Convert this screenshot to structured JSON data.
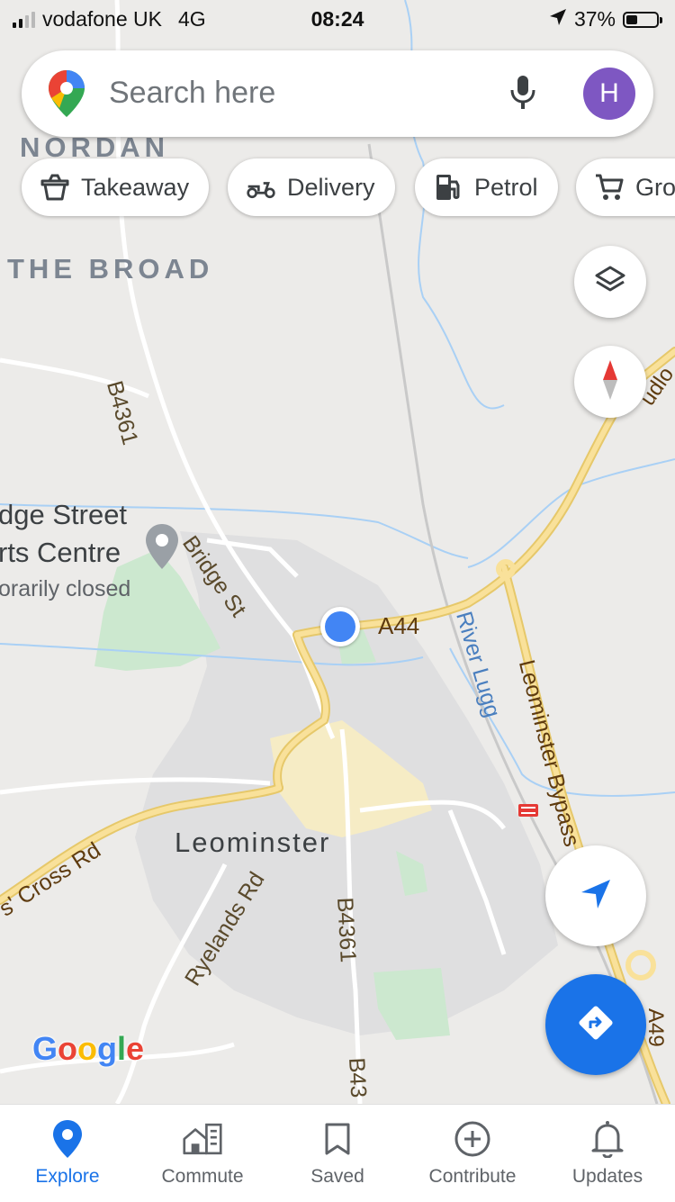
{
  "status_bar": {
    "carrier": "vodafone UK",
    "network": "4G",
    "time": "08:24",
    "battery": "37%",
    "battery_level": 0.37
  },
  "search": {
    "placeholder": "Search here",
    "avatar_initial": "H"
  },
  "chips": [
    {
      "label": "Takeaway",
      "icon": "takeaway-icon"
    },
    {
      "label": "Delivery",
      "icon": "delivery-icon"
    },
    {
      "label": "Petrol",
      "icon": "petrol-icon"
    },
    {
      "label": "Gro",
      "icon": "grocery-cart-icon"
    }
  ],
  "map": {
    "labels": {
      "nordan": "NORDAN",
      "the_broad": "THE BROAD",
      "b4361_north": "B4361",
      "bridge_st": "Bridge St",
      "poi_line1": "dge Street",
      "poi_line2": "rts Centre",
      "poi_status": "orarily closed",
      "a44": "A44",
      "river_lugg": "River Lugg",
      "leominster_bypass": "Leominster Bypass",
      "cross_rd": "s' Cross Rd",
      "town": "Leominster",
      "ryelands_rd": "Ryelands Rd",
      "b4361_south": "B4361",
      "b43_bottom": "B43",
      "a49": "A49",
      "ludlow_partial": "udlo"
    },
    "attribution": "Google"
  },
  "colors": {
    "accent": "#1a73e8",
    "avatar": "#7e57c2",
    "major_road": "#f8dc8a",
    "water": "#aadaff",
    "park": "#c8e6c9"
  },
  "bottom_nav": [
    {
      "label": "Explore",
      "icon": "explore-pin-icon",
      "active": true
    },
    {
      "label": "Commute",
      "icon": "commute-icon",
      "active": false
    },
    {
      "label": "Saved",
      "icon": "bookmark-icon",
      "active": false
    },
    {
      "label": "Contribute",
      "icon": "add-circle-icon",
      "active": false
    },
    {
      "label": "Updates",
      "icon": "bell-icon",
      "active": false
    }
  ]
}
